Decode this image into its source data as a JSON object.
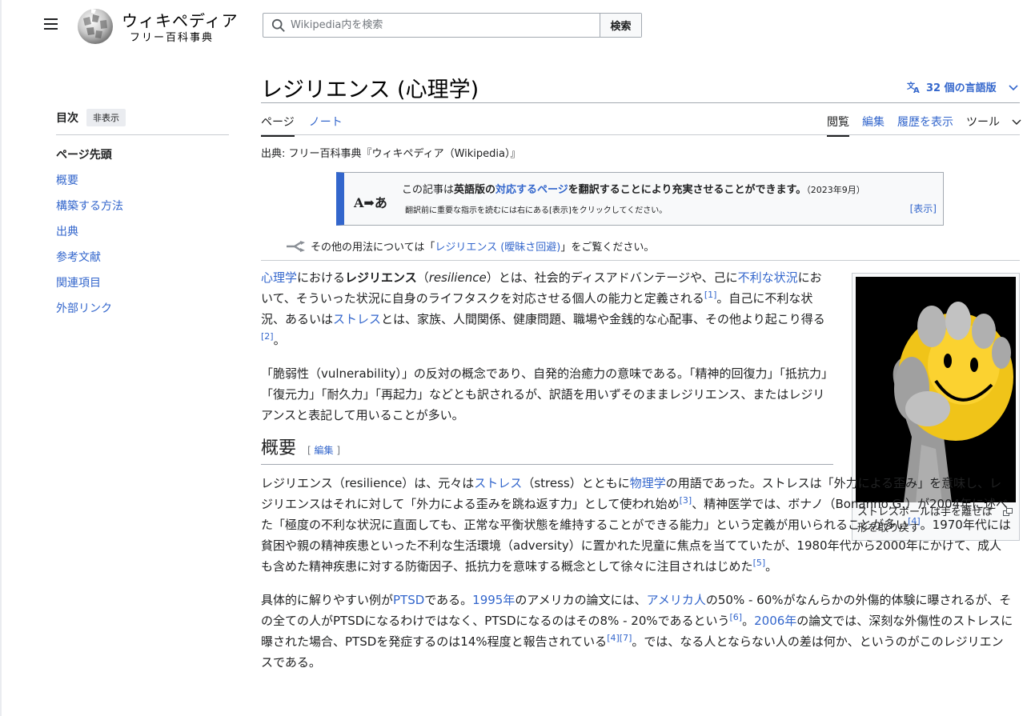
{
  "header": {
    "logo_wordmark": "ウィキペディア",
    "logo_tagline": "フリー百科事典",
    "search_placeholder": "Wikipedia内を検索",
    "search_button": "検索"
  },
  "toc": {
    "title": "目次",
    "hide_label": "非表示",
    "items": [
      "ページ先頭",
      "概要",
      "構築する方法",
      "出典",
      "参考文献",
      "関連項目",
      "外部リンク"
    ]
  },
  "page": {
    "title": "レジリエンス (心理学)",
    "languages_label": "32 個の言語版",
    "tabs_left": [
      "ページ",
      "ノート"
    ],
    "tabs_right": [
      "閲覧",
      "編集",
      "履歴を表示",
      "ツール"
    ],
    "source_line": "出典: フリー百科事典『ウィキペディア（Wikipedia）』"
  },
  "ambox": {
    "icon_text": "A➡あ",
    "main_pre": "この記事は",
    "main_bold1": "英語版の",
    "main_link": "対応するページ",
    "main_bold2": "を翻訳することにより充実させることができます。",
    "date": "（2023年9月）",
    "sub": "翻訳前に重要な指示を読むには右にある[表示]をクリックしてください。",
    "show": "[表示]"
  },
  "hatnote": {
    "pre": "その他の用法については「",
    "link": "レジリエンス (曖昧さ回避)",
    "post": "」をご覧ください。"
  },
  "thumb": {
    "caption": "ストレスボールは手を離せば形を取り戻す"
  },
  "sections": {
    "overview_title": "概要",
    "edit_label": "編集",
    "edit_open": "[ ",
    "edit_close": " ]"
  },
  "colors": {
    "link": "#3366cc",
    "ambox_border": "#3366cc"
  }
}
